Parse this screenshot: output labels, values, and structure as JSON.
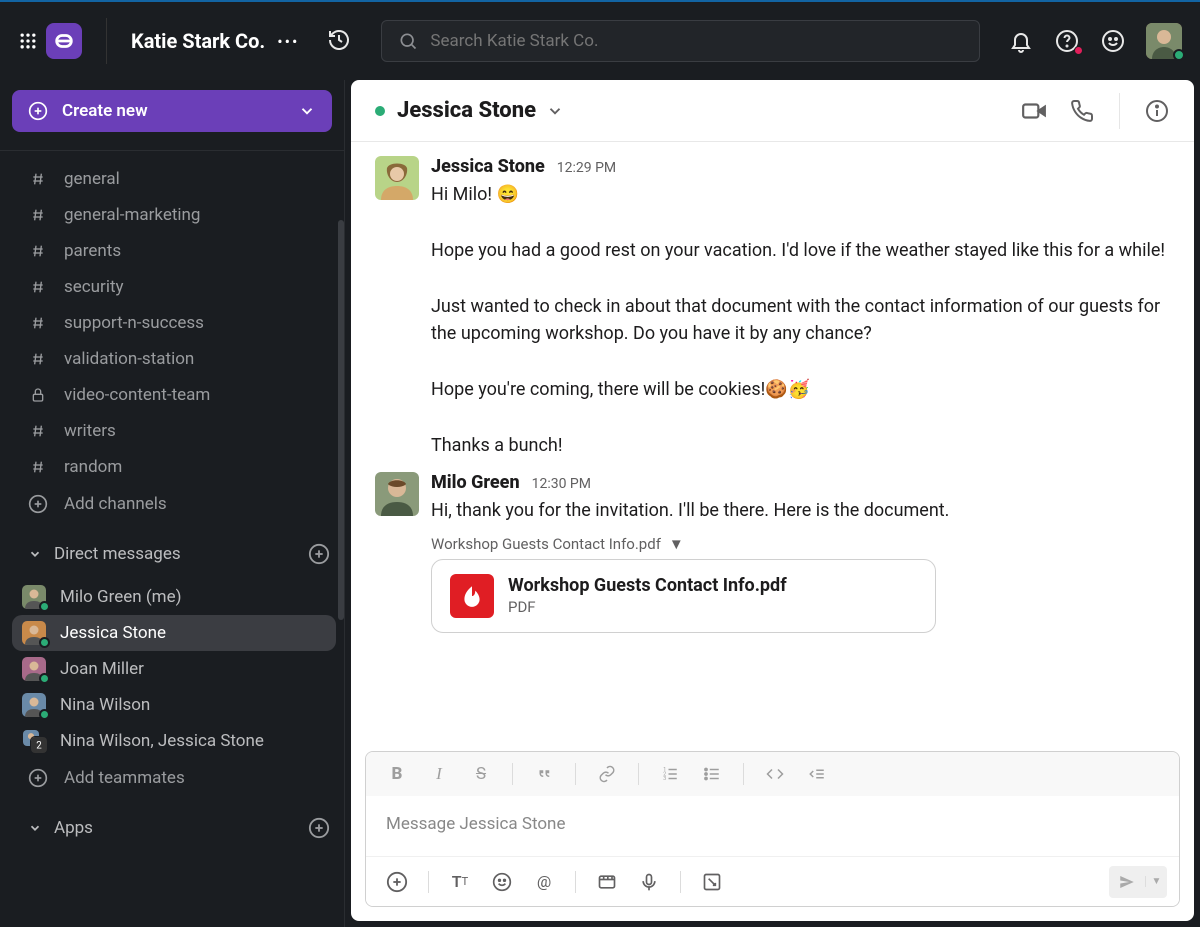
{
  "workspace": {
    "name": "Katie Stark Co."
  },
  "search": {
    "placeholder": "Search Katie Stark Co."
  },
  "create_button": "Create new",
  "channels": [
    {
      "name": "general",
      "icon": "hash"
    },
    {
      "name": "general-marketing",
      "icon": "hash"
    },
    {
      "name": "parents",
      "icon": "hash"
    },
    {
      "name": "security",
      "icon": "hash"
    },
    {
      "name": "support-n-success",
      "icon": "hash"
    },
    {
      "name": "validation-station",
      "icon": "hash"
    },
    {
      "name": "video-content-team",
      "icon": "lock"
    },
    {
      "name": "writers",
      "icon": "hash"
    },
    {
      "name": "random",
      "icon": "hash"
    }
  ],
  "add_channels": "Add channels",
  "sections": {
    "dm_header": "Direct messages",
    "apps_header": "Apps"
  },
  "dms": [
    {
      "name": "Milo Green (me)",
      "active": false,
      "multi": false
    },
    {
      "name": "Jessica Stone",
      "active": true,
      "multi": false
    },
    {
      "name": "Joan Miller",
      "active": false,
      "multi": false
    },
    {
      "name": "Nina Wilson",
      "active": false,
      "multi": false
    },
    {
      "name": "Nina Wilson, Jessica Stone",
      "active": false,
      "multi": true
    }
  ],
  "add_teammates": "Add teammates",
  "chat": {
    "header_name": "Jessica Stone",
    "composer_placeholder": "Message Jessica Stone"
  },
  "messages": [
    {
      "author": "Jessica Stone",
      "time": "12:29 PM",
      "text": "Hi Milo! 😄\n\nHope you had a good rest on your vacation. I'd love if the weather stayed like this for a while!\n\nJust wanted to check in about that document with the contact information of our guests for the upcoming workshop. Do you have it by any chance?\n\nHope you're coming, there will be cookies!🍪🥳\n\nThanks a bunch!"
    },
    {
      "author": "Milo Green",
      "time": "12:30 PM",
      "text": "Hi, thank you for the invitation. I'll be there. Here is the document.",
      "attachment": {
        "label": "Workshop Guests Contact Info.pdf",
        "file_name": "Workshop Guests Contact Info.pdf",
        "file_type": "PDF"
      }
    }
  ],
  "colors": {
    "brand": "#6b3fb8",
    "presence": "#2bac76",
    "pdf": "#e01e24"
  }
}
